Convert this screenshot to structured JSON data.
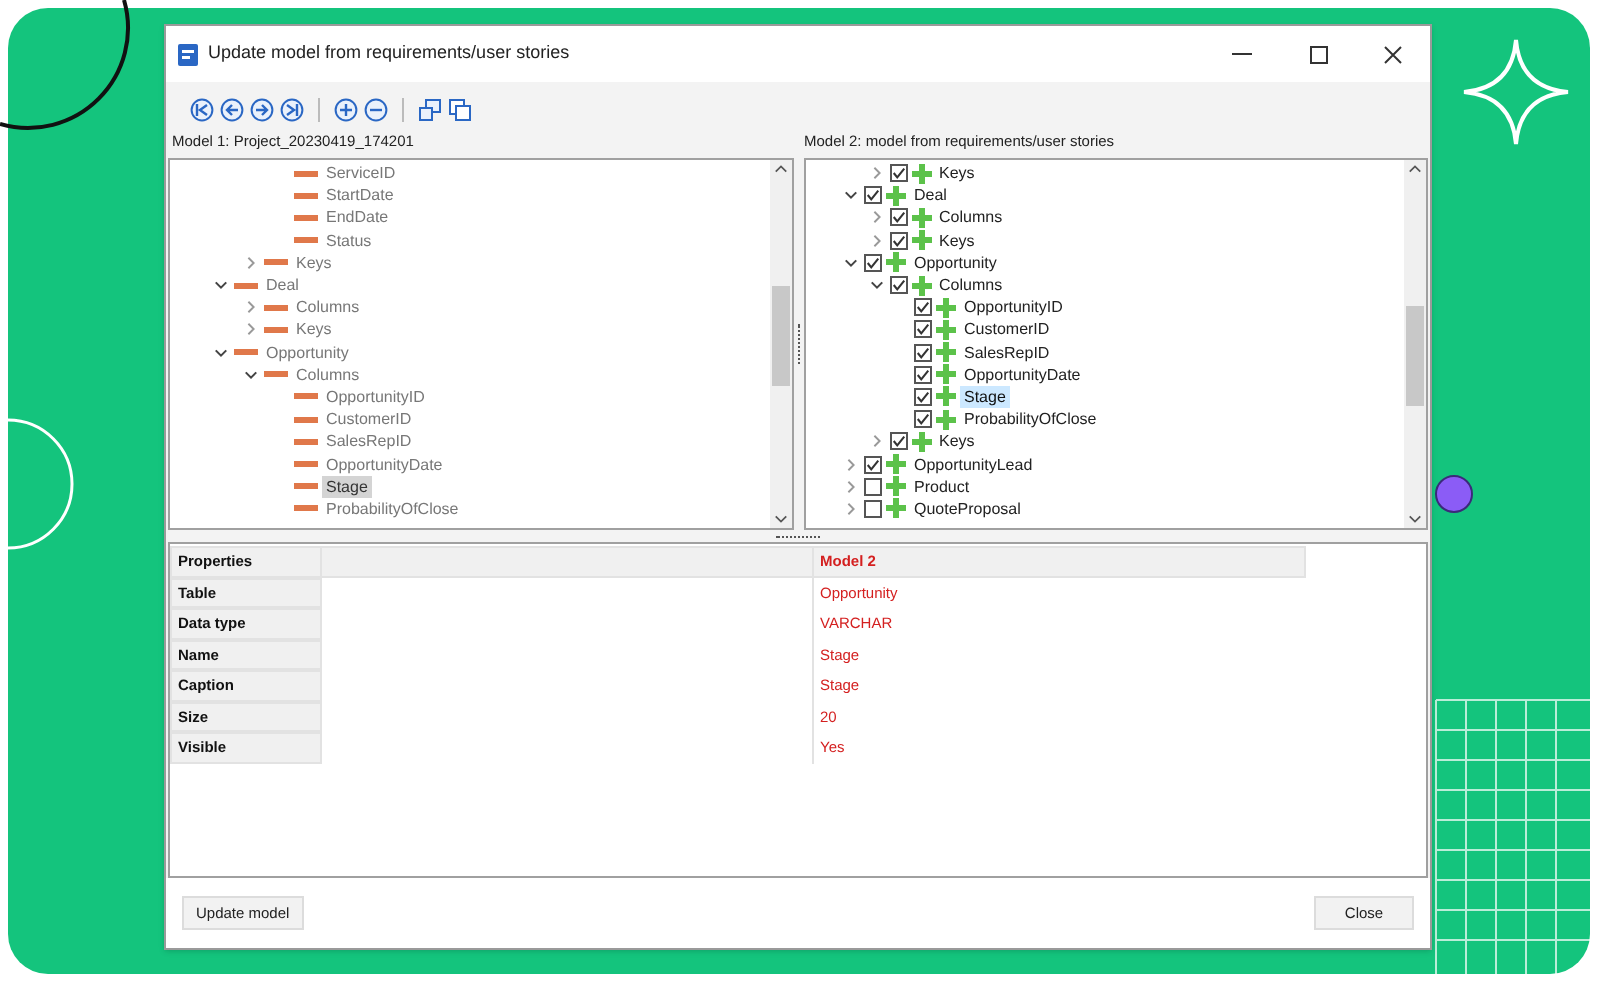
{
  "window": {
    "title": "Update model from requirements/user stories"
  },
  "model1": {
    "label": "Model 1: Project_20230419_174201",
    "tree": [
      {
        "kind": "continued",
        "children": [
          {
            "kind": "continued",
            "children": [
              {
                "kind": "node",
                "label": "ServiceID",
                "selected": false
              },
              {
                "kind": "node",
                "label": "StartDate",
                "selected": false
              },
              {
                "kind": "node",
                "label": "EndDate",
                "selected": false
              },
              {
                "kind": "node",
                "label": "Status",
                "selected": false
              }
            ]
          },
          {
            "kind": "node",
            "label": "Keys",
            "expanded": false,
            "selected": false
          }
        ]
      },
      {
        "kind": "node",
        "label": "Deal",
        "expanded": true,
        "selected": false,
        "children": [
          {
            "kind": "node",
            "label": "Columns",
            "expanded": false,
            "selected": false
          },
          {
            "kind": "node",
            "label": "Keys",
            "expanded": false,
            "selected": false
          }
        ]
      },
      {
        "kind": "node",
        "label": "Opportunity",
        "expanded": true,
        "selected": false,
        "children": [
          {
            "kind": "node",
            "label": "Columns",
            "expanded": true,
            "selected": false,
            "children": [
              {
                "kind": "node",
                "label": "OpportunityID",
                "selected": false
              },
              {
                "kind": "node",
                "label": "CustomerID",
                "selected": false
              },
              {
                "kind": "node",
                "label": "SalesRepID",
                "selected": false
              },
              {
                "kind": "node",
                "label": "OpportunityDate",
                "selected": false
              },
              {
                "kind": "node",
                "label": "Stage",
                "selected": true
              },
              {
                "kind": "node",
                "label": "ProbabilityOfClose",
                "selected": false
              }
            ]
          }
        ]
      }
    ]
  },
  "model2": {
    "label": "Model 2: model from requirements/user stories",
    "tree": [
      {
        "kind": "continued",
        "children": [
          {
            "kind": "node",
            "label": "Keys",
            "expanded": false,
            "checked": true,
            "selected": false
          }
        ]
      },
      {
        "kind": "node",
        "label": "Deal",
        "expanded": true,
        "checked": true,
        "selected": false,
        "children": [
          {
            "kind": "node",
            "label": "Columns",
            "expanded": false,
            "checked": true,
            "selected": false
          },
          {
            "kind": "node",
            "label": "Keys",
            "expanded": false,
            "checked": true,
            "selected": false
          }
        ]
      },
      {
        "kind": "node",
        "label": "Opportunity",
        "expanded": true,
        "checked": true,
        "selected": false,
        "children": [
          {
            "kind": "node",
            "label": "Columns",
            "expanded": true,
            "checked": true,
            "selected": false,
            "children": [
              {
                "kind": "node",
                "label": "OpportunityID",
                "checked": true,
                "selected": false
              },
              {
                "kind": "node",
                "label": "CustomerID",
                "checked": true,
                "selected": false
              },
              {
                "kind": "node",
                "label": "SalesRepID",
                "checked": true,
                "selected": false
              },
              {
                "kind": "node",
                "label": "OpportunityDate",
                "checked": true,
                "selected": false
              },
              {
                "kind": "node",
                "label": "Stage",
                "checked": true,
                "selected": true
              },
              {
                "kind": "node",
                "label": "ProbabilityOfClose",
                "checked": true,
                "selected": false
              }
            ]
          },
          {
            "kind": "node",
            "label": "Keys",
            "expanded": false,
            "checked": true,
            "selected": false
          }
        ]
      },
      {
        "kind": "node",
        "label": "OpportunityLead",
        "expanded": false,
        "checked": true,
        "selected": false
      },
      {
        "kind": "node",
        "label": "Product",
        "expanded": false,
        "checked": false,
        "selected": false
      },
      {
        "kind": "node",
        "label": "QuoteProposal",
        "expanded": false,
        "checked": false,
        "selected": false
      }
    ]
  },
  "properties": {
    "columns": [
      "Properties",
      "Model 2"
    ],
    "rows": [
      {
        "name": "Table",
        "value": "Opportunity"
      },
      {
        "name": "Data type",
        "value": "VARCHAR"
      },
      {
        "name": "Name",
        "value": "Stage"
      },
      {
        "name": "Caption",
        "value": "Stage"
      },
      {
        "name": "Size",
        "value": "20"
      },
      {
        "name": "Visible",
        "value": "Yes"
      }
    ]
  },
  "buttons": [
    {
      "label": "Update model"
    },
    {
      "label": "Close"
    }
  ]
}
